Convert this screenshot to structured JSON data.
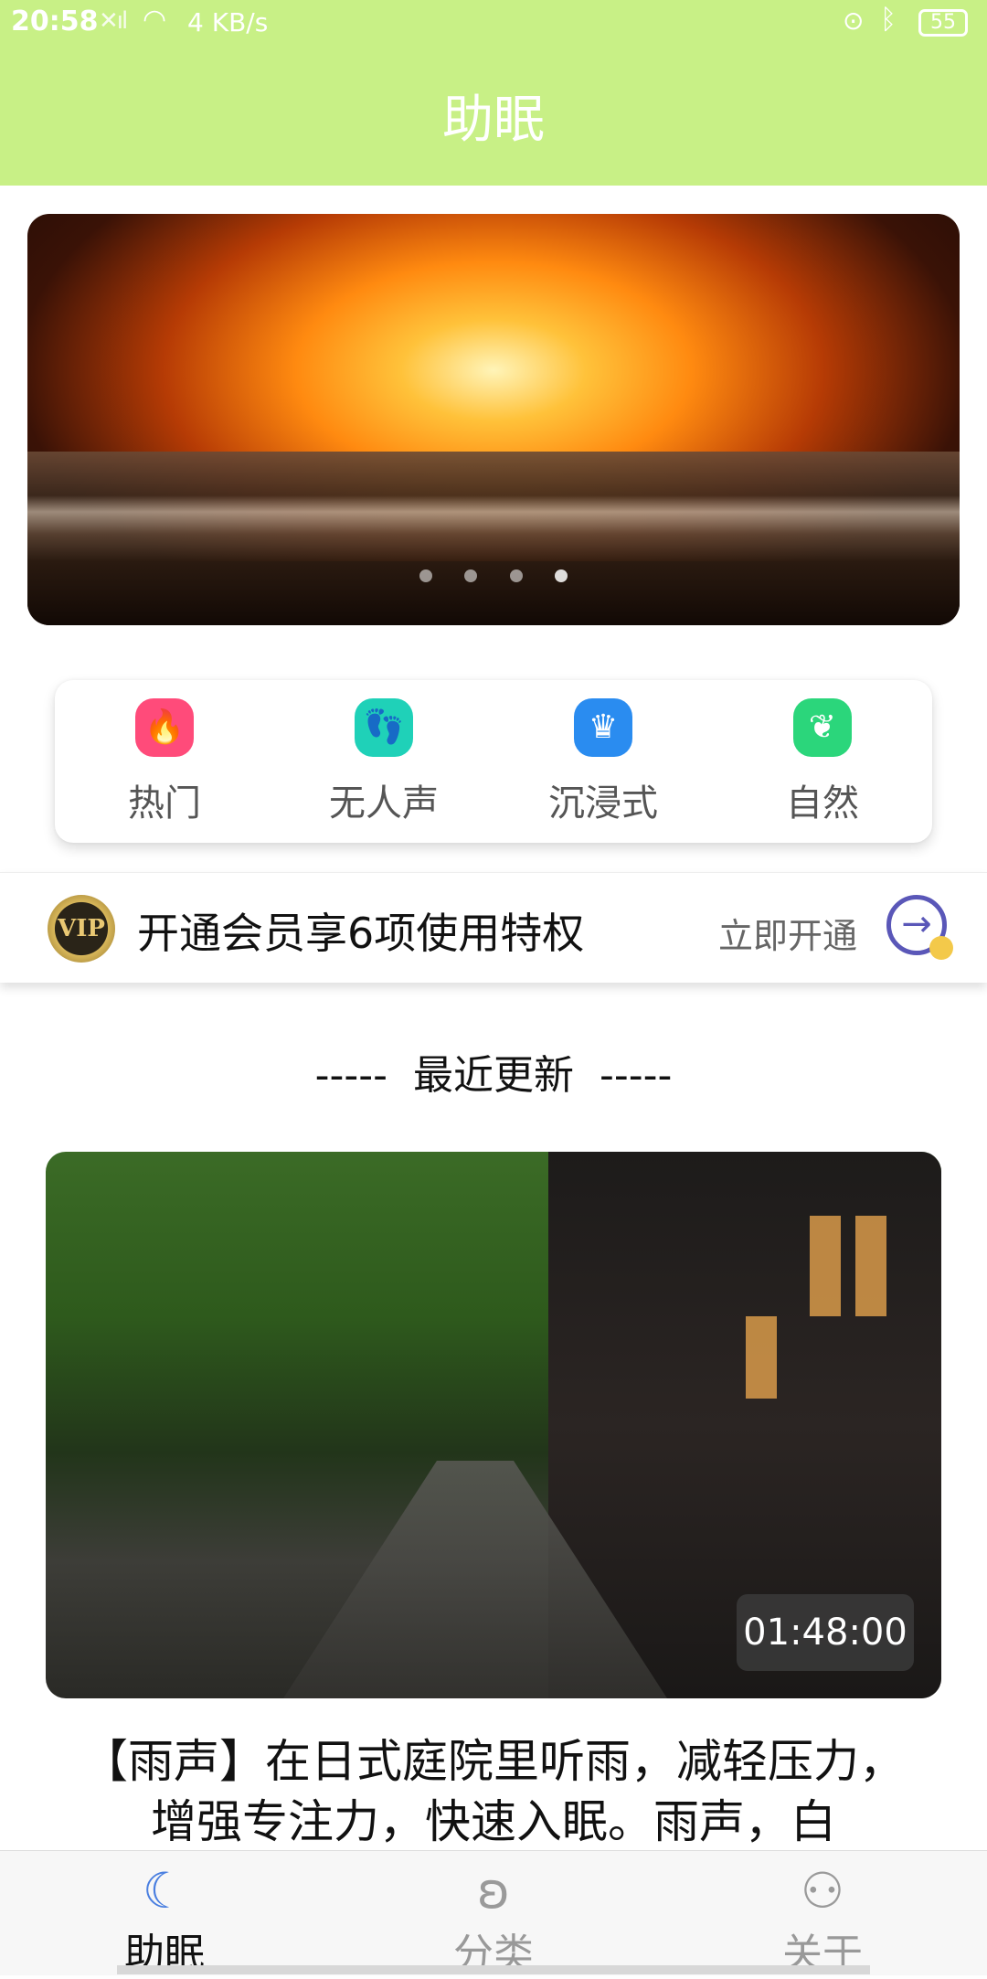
{
  "status_bar": {
    "time": "20:58",
    "signal_icon": "signal-icon",
    "wifi_icon": "wifi-icon",
    "net_speed": "4 KB/s",
    "lock_icon": "lock-icon",
    "bluetooth_icon": "bluetooth-icon",
    "battery": "55"
  },
  "header": {
    "title": "助眠"
  },
  "colors": {
    "accent": "#c8f086",
    "active_tab": "#4a7fe0",
    "vip_arrow": "#5a57b8"
  },
  "banner": {
    "dots": 4,
    "active_dot": 4
  },
  "categories": [
    {
      "label": "热门",
      "icon": "fire-icon",
      "color": "#ff4b7a"
    },
    {
      "label": "无人声",
      "icon": "footprint-icon",
      "color": "#1fd1b8"
    },
    {
      "label": "沉浸式",
      "icon": "crown-icon",
      "color": "#2a8cf0"
    },
    {
      "label": "自然",
      "icon": "leaf-icon",
      "color": "#2bd67b"
    }
  ],
  "vip": {
    "badge": "VIP",
    "text": "开通会员享6项使用特权",
    "action": "立即开通",
    "arrow_icon": "arrow-right-icon"
  },
  "section": {
    "title": "-----  最近更新  -----"
  },
  "card": {
    "duration": "01:48:00",
    "title": "【雨声】在日式庭院里听雨，减轻压力，增强专注力，快速入眠。雨声，白"
  },
  "tabs": [
    {
      "label": "助眠",
      "icon": "moon-sleep-icon",
      "active": true
    },
    {
      "label": "分类",
      "icon": "ear-icon",
      "active": false
    },
    {
      "label": "关于",
      "icon": "users-icon",
      "active": false
    }
  ]
}
